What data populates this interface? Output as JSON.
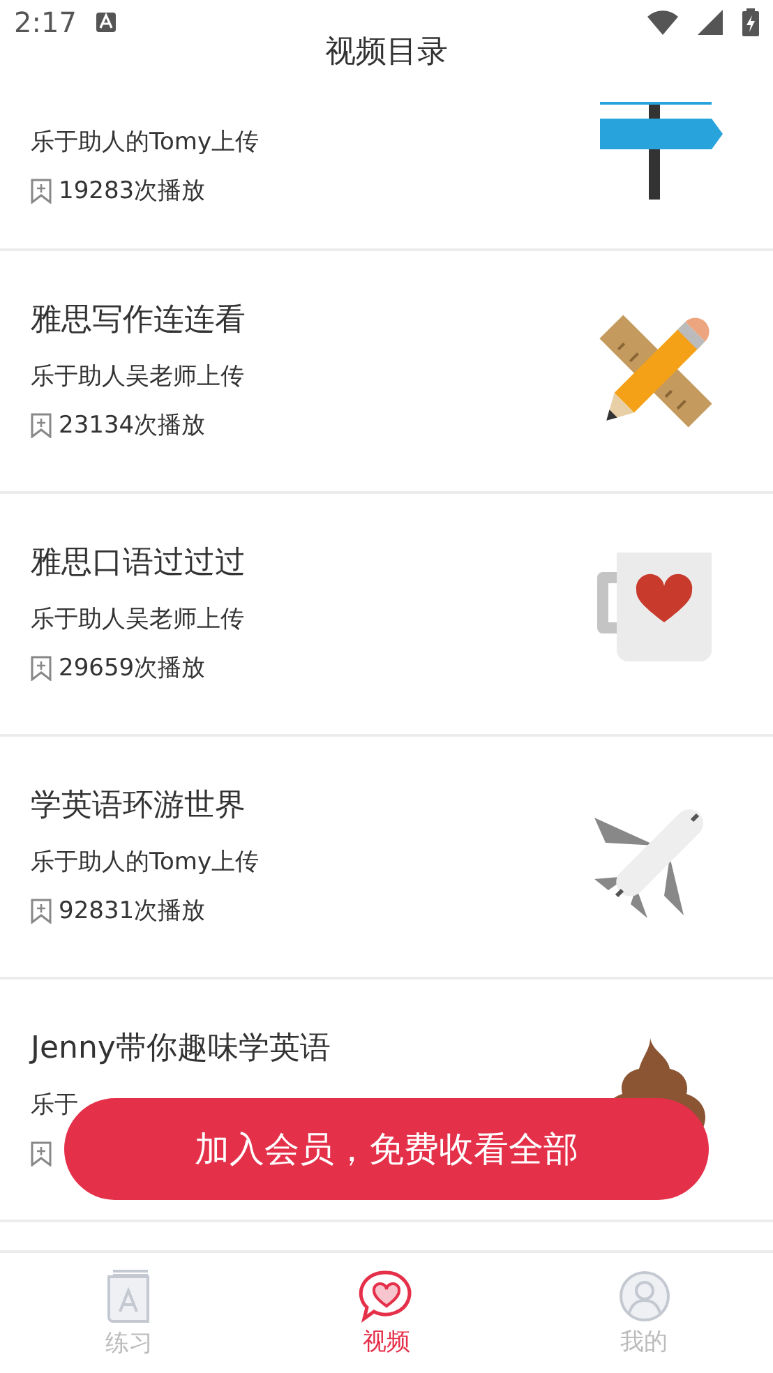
{
  "status_bar": {
    "time": "2:17"
  },
  "header": {
    "title": "视频目录"
  },
  "videos": [
    {
      "uploader": "乐于助人的Tomy上传",
      "plays": "19283次播放",
      "kind": "signpost"
    },
    {
      "title": "雅思写作连连看",
      "uploader": "乐于助人吴老师上传",
      "plays": "23134次播放",
      "kind": "pencil"
    },
    {
      "title": "雅思口语过过过",
      "uploader": "乐于助人吴老师上传",
      "plays": "29659次播放",
      "kind": "mug"
    },
    {
      "title": "学英语环游世界",
      "uploader": "乐于助人的Tomy上传",
      "plays": "92831次播放",
      "kind": "plane"
    },
    {
      "title": "Jenny带你趣味学英语",
      "uploader": "乐于",
      "kind": "poop"
    }
  ],
  "banner": {
    "label": "加入会员，免费收看全部"
  },
  "tabs": [
    {
      "label": "练习",
      "kind": "book",
      "selected": false
    },
    {
      "label": "视频",
      "kind": "heart",
      "selected": true
    },
    {
      "label": "我的",
      "kind": "person",
      "selected": false
    }
  ]
}
